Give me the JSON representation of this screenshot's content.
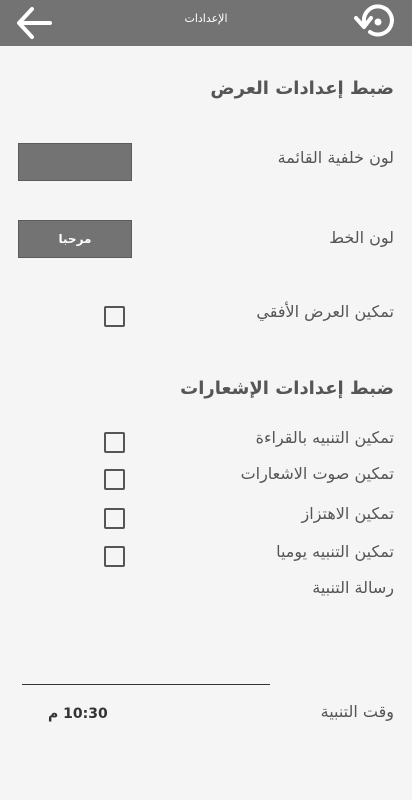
{
  "header": {
    "title": "الإعدادات"
  },
  "display_section": {
    "title": "ضبط إعدادات العرض",
    "list_bg_label": "لون خلفية القائمة",
    "font_color_label": "لون الخط",
    "font_color_sample": "مرحبا",
    "landscape_label": "تمكين العرض الأفقي",
    "landscape_checked": false
  },
  "notifications_section": {
    "title": "ضبط إعدادات الإشعارات",
    "read_alert_label": "تمكين التنبيه بالقراءة",
    "read_alert_checked": false,
    "sound_label": "تمكين صوت الاشعارات",
    "sound_checked": false,
    "vibrate_label": "تمكين الاهتزاز",
    "vibrate_checked": false,
    "daily_label": "تمكين التنبيه يوميا",
    "daily_checked": false,
    "message_label": "رسالة التنبية",
    "message_value": "",
    "time_label": "وقت التنبية",
    "time_value": "10:30 م"
  },
  "colors": {
    "toolbar": "#737373",
    "background": "#f5f5f5"
  },
  "icons": {
    "back": "arrow-left-icon",
    "restore": "restore-icon"
  }
}
